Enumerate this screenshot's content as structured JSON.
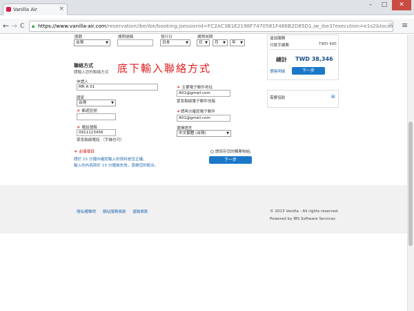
{
  "browser": {
    "tab_title": "Vanilla Air",
    "tab_close": "×",
    "win_min": "–",
    "win_max": "□",
    "win_close": "✕",
    "back": "←",
    "forward": "→",
    "reload": "C",
    "url_domain": "https://www.vanilla-air.com",
    "url_rest": "/reservation/ibe/ibe/booking;jsessionid=FC2AC3B1E2198F7470581F486B2D85D1.jw_ibe3?execution=e1s2&locale=tw&lt=&ag-",
    "star_icon": "☆",
    "menu_icon": "≡"
  },
  "form": {
    "top_labels": {
      "nationality": "國籍",
      "passport": "護照號碼",
      "issue_date": "發行日",
      "expiry": "護照效期"
    },
    "top_values": {
      "nationality": "台灣",
      "issue_date": "日本",
      "day": "日",
      "month": "月",
      "year": "年"
    },
    "contact_title": "聯絡方式",
    "contact_sub": "請輸入您的聯絡方式",
    "annotation": "底下輸入聯絡方式",
    "applicant_label": "申請人",
    "applicant_value": "MR A 01",
    "country_label": "國家",
    "country_value": "台灣",
    "postal_label": "郵遞區號",
    "phone_label": "電話號碼",
    "phone_value": "0911123456",
    "phone_note": "緊急聯絡電話 （手機也可）",
    "email_label": "主要電子郵件地址",
    "email_value": "A01@gmail.com",
    "email_note": "緊急聯絡電子郵件信箱",
    "email_confirm_label": "請再次確認電子郵件",
    "email_confirm_value": "A01@gmail.com",
    "lang_label": "選擇語言",
    "lang_value": "中文繁體 (台灣)",
    "required_note": "＊ 必填項目",
    "checkbox_label": "請保存您的購票物組。",
    "notice_line1": "請於 15 分鐘內確認輸入的資料是否正確。",
    "notice_line2": "輸入的內容將於 15 分鐘後失效，感謝您的配合。",
    "next_button": "下一步"
  },
  "sidebar": {
    "fee_header": "追加服務",
    "fee_label": "付款手續費",
    "fee_value": "TWD 400",
    "total_label": "總計",
    "total_value": "TWD 38,346",
    "breakdown_link": "價格明細",
    "next_button": "下一步",
    "help_label": "需要協助",
    "help_icon": "⊞"
  },
  "footer": {
    "links": [
      "隱私權聲明",
      "網站服務條款",
      "運輸條款"
    ],
    "copyright": "© 2013 Vanilla -  All rights reserved",
    "powered": "Powered by IBS Software Services"
  }
}
